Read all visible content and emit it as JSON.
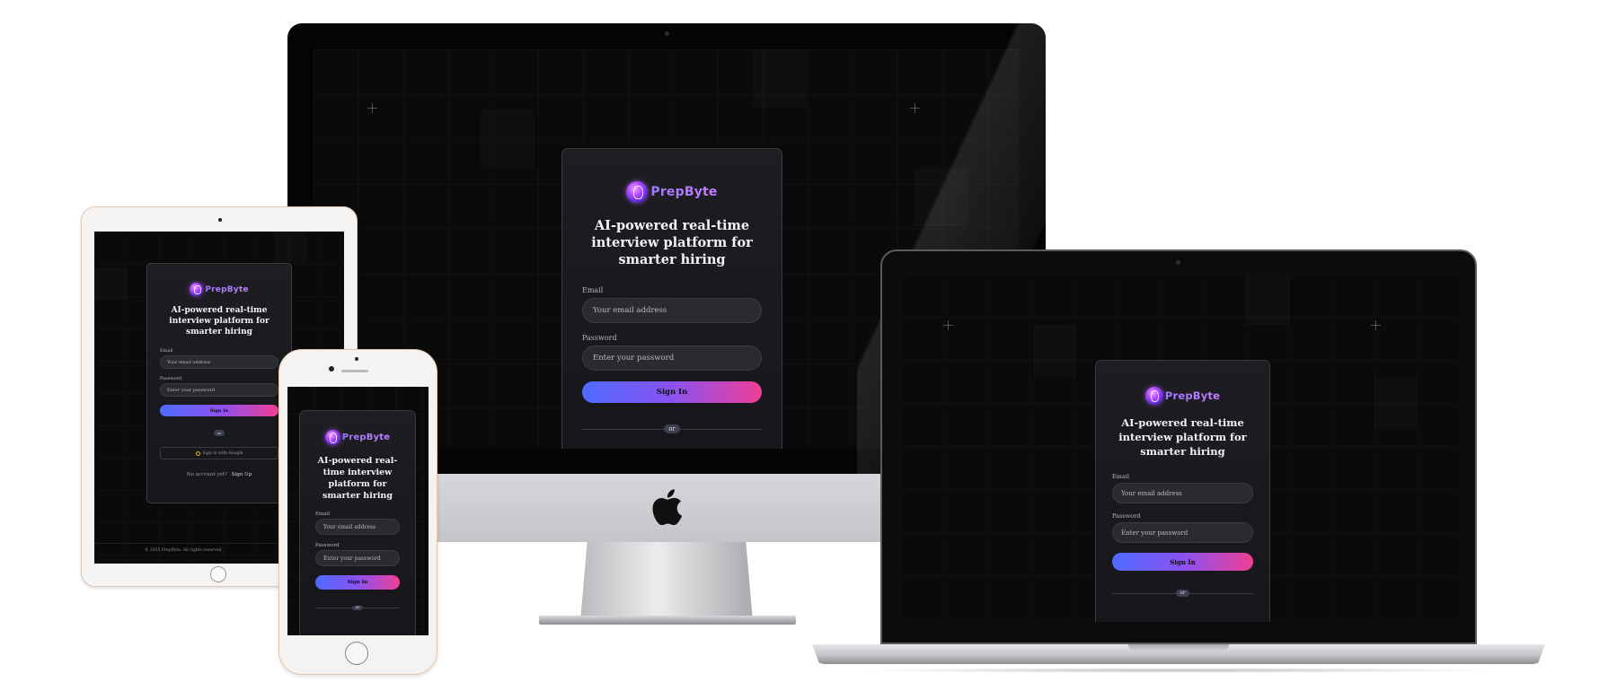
{
  "app": {
    "brand_name": "PrepByte",
    "tagline": "AI-powered real-time interview platform for smarter hiring"
  },
  "form": {
    "email_label": "Email",
    "email_placeholder": "Your email address",
    "password_label": "Password",
    "password_placeholder": "Enter your password",
    "sign_in_label": "Sign In",
    "divider_label": "or",
    "google_label": "Sign in with Google",
    "no_account_text": "No account yet?",
    "sign_up_label": "Sign Up"
  },
  "footer": {
    "copyright": "© 2025 PrepByte. All rights reserved."
  },
  "devices": [
    "desktop-monitor",
    "tablet",
    "phone",
    "laptop"
  ],
  "colors": {
    "background": "#0a0a0b",
    "card": "#1b1b20",
    "button_gradient_start": "#4f6bff",
    "button_gradient_mid": "#8a52f0",
    "button_gradient_end": "#ef3f95",
    "brand_purple": "#b14cff"
  }
}
